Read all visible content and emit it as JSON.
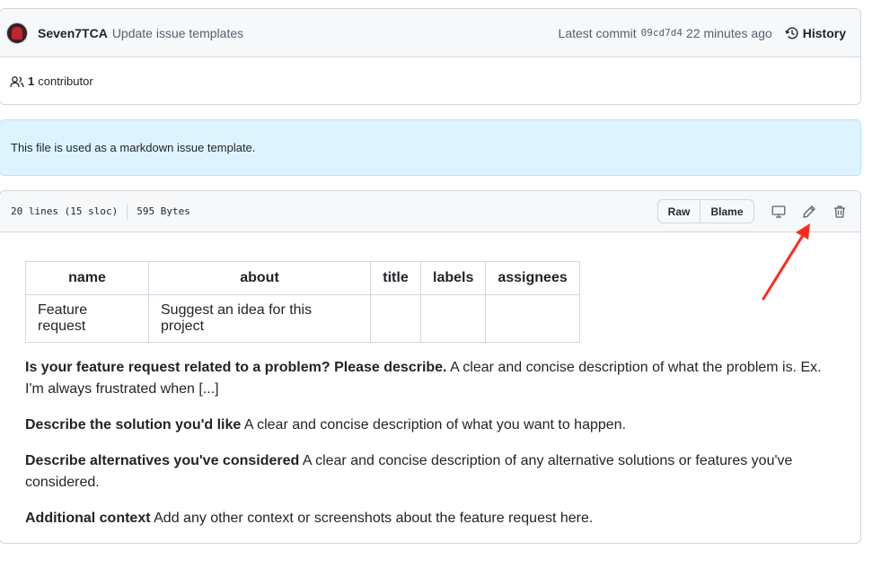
{
  "commit": {
    "author": "Seven7TCA",
    "message": "Update issue templates",
    "latest_label": "Latest commit",
    "sha": "09cd7d4",
    "ago": "22 minutes ago",
    "history_label": "History"
  },
  "contributors": {
    "count": "1",
    "label": "contributor"
  },
  "flash": {
    "text": "This file is used as a markdown issue template."
  },
  "file": {
    "lines": "20 lines (15 sloc)",
    "size": "595 Bytes",
    "raw_label": "Raw",
    "blame_label": "Blame"
  },
  "table": {
    "headers": [
      "name",
      "about",
      "title",
      "labels",
      "assignees"
    ],
    "row": [
      "Feature request",
      "Suggest an idea for this project",
      "",
      "",
      ""
    ]
  },
  "paragraphs": [
    {
      "bold": "Is your feature request related to a problem? Please describe.",
      "text": " A clear and concise description of what the problem is. Ex. I'm always frustrated when [...]"
    },
    {
      "bold": "Describe the solution you'd like",
      "text": " A clear and concise description of what you want to happen."
    },
    {
      "bold": "Describe alternatives you've considered",
      "text": " A clear and concise description of any alternative solutions or features you've considered."
    },
    {
      "bold": "Additional context",
      "text": " Add any other context or screenshots about the feature request here."
    }
  ],
  "icons": {
    "history": "history-icon",
    "contributors": "people-icon",
    "display": "display-icon",
    "edit": "pencil-icon",
    "delete": "trash-icon"
  },
  "colors": {
    "annotation": "#ff2a1f",
    "flash_bg": "#ddf4ff"
  }
}
